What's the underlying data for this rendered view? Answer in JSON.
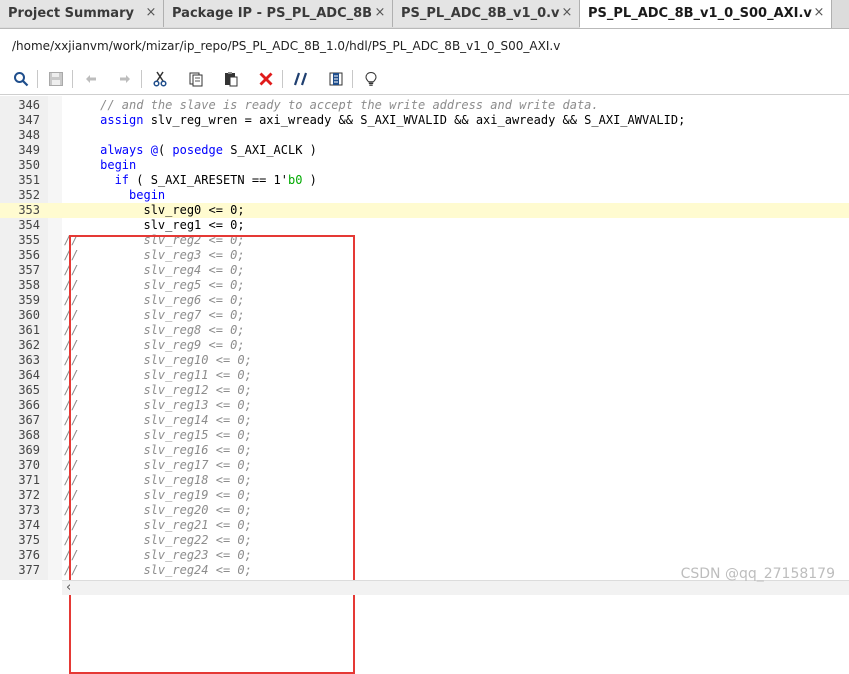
{
  "tabs": [
    {
      "label": "Project Summary",
      "close": "×",
      "active": false
    },
    {
      "label": "Package IP - PS_PL_ADC_8B",
      "close": "×",
      "active": false
    },
    {
      "label": "PS_PL_ADC_8B_v1_0.v",
      "close": "×",
      "active": false
    },
    {
      "label": "PS_PL_ADC_8B_v1_0_S00_AXI.v",
      "close": "×",
      "active": true
    }
  ],
  "file_path": "/home/xxjianvm/work/mizar/ip_repo/PS_PL_ADC_8B_1.0/hdl/PS_PL_ADC_8B_v1_0_S00_AXI.v",
  "toolbar": {
    "icons": [
      "search-icon",
      "save-icon",
      "undo-icon",
      "redo-icon",
      "cut-icon",
      "copy-icon",
      "paste-icon",
      "delete-icon",
      "comment-icon",
      "columns-icon",
      "lightbulb-icon"
    ]
  },
  "editor": {
    "current_line": 353,
    "lines": [
      {
        "n": "346",
        "code": "     // and the slave is ready to accept the write address and write data."
      },
      {
        "n": "347",
        "code": "     assign slv_reg_wren = axi_wready && S_AXI_WVALID && axi_awready && S_AXI_AWVALID;"
      },
      {
        "n": "348",
        "code": ""
      },
      {
        "n": "349",
        "code": "     always @( posedge S_AXI_ACLK )"
      },
      {
        "n": "350",
        "code": "     begin"
      },
      {
        "n": "351",
        "code": "       if ( S_AXI_ARESETN == 1'b0 )"
      },
      {
        "n": "352",
        "code": "         begin"
      },
      {
        "n": "353",
        "code": "           slv_reg0 <= 0;"
      },
      {
        "n": "354",
        "code": "           slv_reg1 <= 0;"
      },
      {
        "n": "355",
        "code": "//         slv_reg2 <= 0;"
      },
      {
        "n": "356",
        "code": "//         slv_reg3 <= 0;"
      },
      {
        "n": "357",
        "code": "//         slv_reg4 <= 0;"
      },
      {
        "n": "358",
        "code": "//         slv_reg5 <= 0;"
      },
      {
        "n": "359",
        "code": "//         slv_reg6 <= 0;"
      },
      {
        "n": "360",
        "code": "//         slv_reg7 <= 0;"
      },
      {
        "n": "361",
        "code": "//         slv_reg8 <= 0;"
      },
      {
        "n": "362",
        "code": "//         slv_reg9 <= 0;"
      },
      {
        "n": "363",
        "code": "//         slv_reg10 <= 0;"
      },
      {
        "n": "364",
        "code": "//         slv_reg11 <= 0;"
      },
      {
        "n": "365",
        "code": "//         slv_reg12 <= 0;"
      },
      {
        "n": "366",
        "code": "//         slv_reg13 <= 0;"
      },
      {
        "n": "367",
        "code": "//         slv_reg14 <= 0;"
      },
      {
        "n": "368",
        "code": "//         slv_reg15 <= 0;"
      },
      {
        "n": "369",
        "code": "//         slv_reg16 <= 0;"
      },
      {
        "n": "370",
        "code": "//         slv_reg17 <= 0;"
      },
      {
        "n": "371",
        "code": "//         slv_reg18 <= 0;"
      },
      {
        "n": "372",
        "code": "//         slv_reg19 <= 0;"
      },
      {
        "n": "373",
        "code": "//         slv_reg20 <= 0;"
      },
      {
        "n": "374",
        "code": "//         slv_reg21 <= 0;"
      },
      {
        "n": "375",
        "code": "//         slv_reg22 <= 0;"
      },
      {
        "n": "376",
        "code": "//         slv_reg23 <= 0;"
      },
      {
        "n": "377",
        "code": "//         slv_reg24 <= 0;"
      }
    ]
  },
  "scroll_arrow": "‹",
  "watermark": "CSDN @qq_27158179",
  "colors": {
    "keyword": "#0000ff",
    "comment": "#8c8c8c",
    "current_line": "#fffbd0",
    "annotation_box": "#e53935"
  }
}
